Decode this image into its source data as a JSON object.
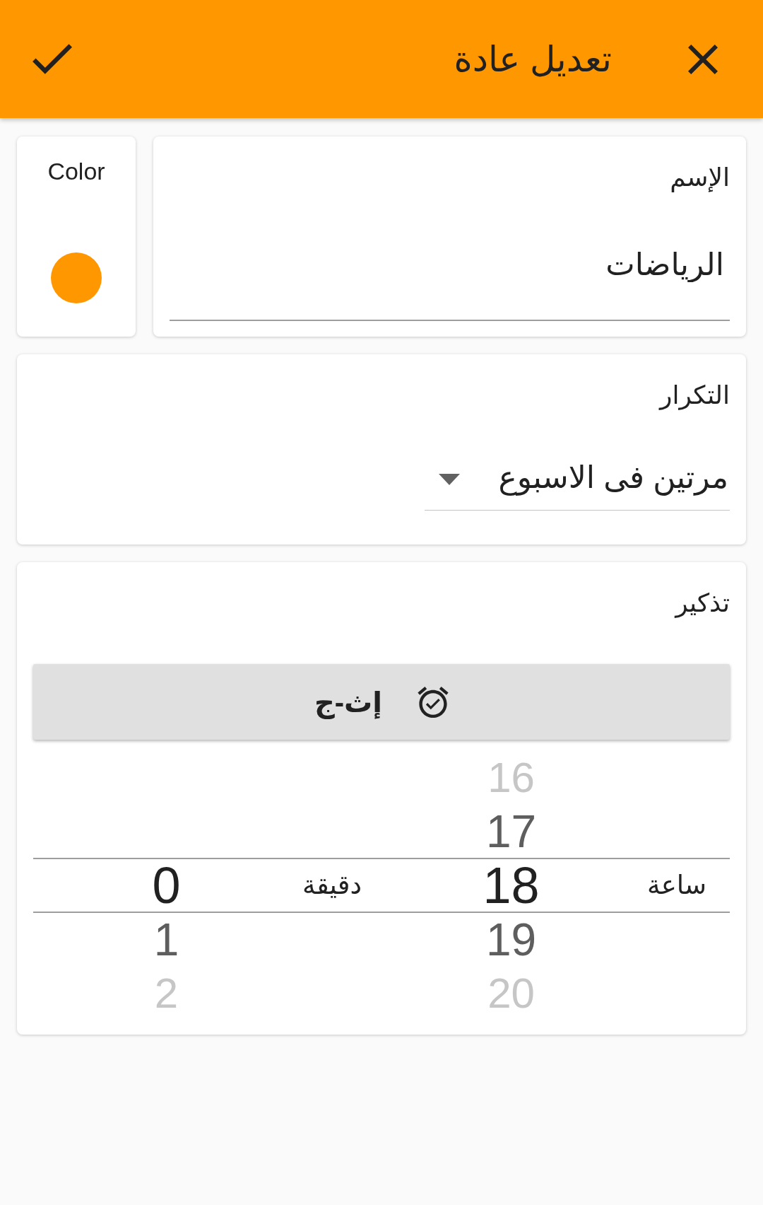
{
  "app_bar": {
    "title": "تعديل عادة"
  },
  "color_card": {
    "label": "Color",
    "color": "#ff9800"
  },
  "name_field": {
    "label": "الإسم",
    "value": "الرياضات"
  },
  "repeat_field": {
    "label": "التكرار",
    "value": "مرتين فى الاسبوع"
  },
  "reminder": {
    "label": "تذكير",
    "button": {
      "label": "إث-ج"
    },
    "picker": {
      "columns": [
        {
          "label": "ساعة",
          "items": [
            {
              "text": "16",
              "selected": false
            },
            {
              "text": "17",
              "selected": false
            },
            {
              "text": "18",
              "selected": true
            },
            {
              "text": "19",
              "selected": false
            },
            {
              "text": "20",
              "selected": false
            }
          ]
        },
        {
          "label": "دقيقة",
          "items": [
            {
              "text": "0",
              "selected": true
            },
            {
              "text": "1",
              "selected": false
            },
            {
              "text": "2",
              "selected": false
            }
          ]
        }
      ]
    }
  }
}
